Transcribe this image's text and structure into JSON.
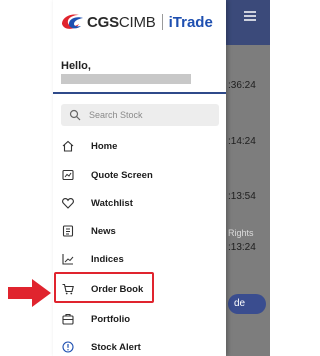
{
  "brand": {
    "name_bold": "CGS",
    "name_light": "CIMB",
    "app_name": "iTrade",
    "colors": {
      "logo_red": "#e0242e",
      "logo_blue": "#1e4fb0"
    }
  },
  "user": {
    "greeting": "Hello,"
  },
  "search": {
    "placeholder": "Search Stock"
  },
  "menu": {
    "items": [
      {
        "label": "Home",
        "icon": "home-icon"
      },
      {
        "label": "Quote Screen",
        "icon": "quote-screen-icon"
      },
      {
        "label": "Watchlist",
        "icon": "heart-icon"
      },
      {
        "label": "News",
        "icon": "news-icon"
      },
      {
        "label": "Indices",
        "icon": "chart-line-icon"
      },
      {
        "label": "Order Book",
        "icon": "cart-icon"
      },
      {
        "label": "Portfolio",
        "icon": "portfolio-icon"
      },
      {
        "label": "Stock Alert",
        "icon": "alert-icon"
      }
    ],
    "highlighted": "Order Book",
    "highlight_color": "#e0242e"
  },
  "background_screen": {
    "times": [
      ":36:24",
      ":14:24",
      ":13:54",
      ":13:24"
    ],
    "muted_text": "Rights",
    "pill_label": "de"
  }
}
